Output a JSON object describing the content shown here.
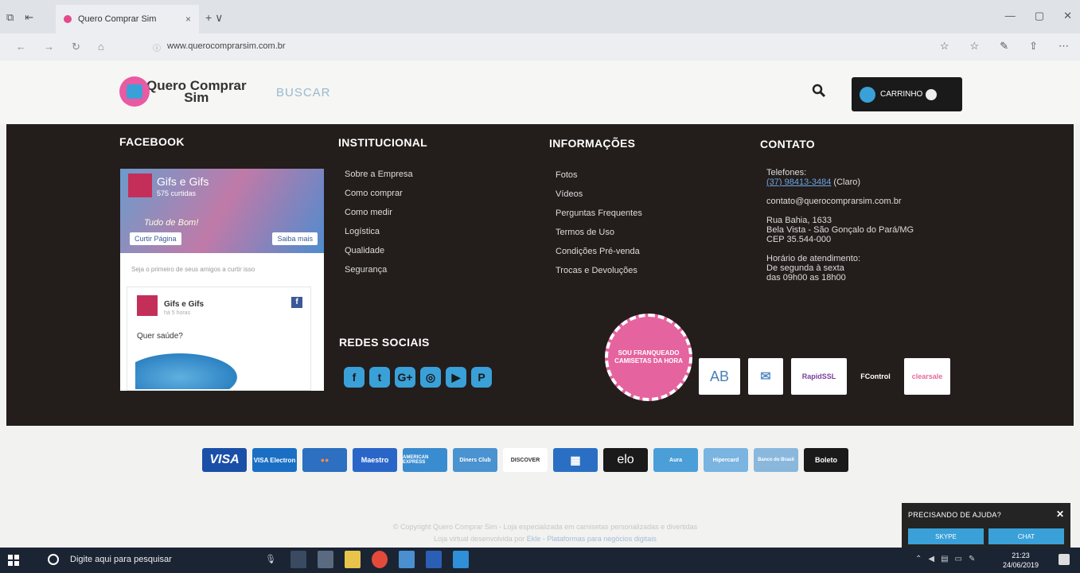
{
  "browser": {
    "tab_title": "Quero Comprar Sim",
    "tab_close": "×",
    "new_tab": "+ ∨",
    "url": "www.querocomprarsim.com.br",
    "window_controls": [
      "—",
      "▢",
      "✕"
    ]
  },
  "header": {
    "logo_line1": "Quero Comprar",
    "logo_line2": "Sim",
    "search_placeholder": "BUSCAR",
    "cart_label": "CARRINHO"
  },
  "footer": {
    "facebook_heading": "FACEBOOK",
    "institucional_heading": "INSTITUCIONAL",
    "informacoes_heading": "INFORMAÇÕES",
    "contato_heading": "CONTATO",
    "redes_heading": "REDES SOCIAIS",
    "fb": {
      "page_name": "Gifs e Gifs",
      "likes": "575 curtidas",
      "tagline": "Tudo de Bom!",
      "like_button": "Curtir Página",
      "more_button": "Saiba mais",
      "friends_text": "Seja o primeiro de seus amigos a curtir isso",
      "post_name": "Gifs e Gifs",
      "post_time": "há 5 horas",
      "post_text": "Quer saúde?"
    },
    "institucional_links": [
      "Sobre a Empresa",
      "Como comprar",
      "Como medir",
      "Logística",
      "Qualidade",
      "Segurança"
    ],
    "informacoes_links": [
      "Fotos",
      "Vídeos",
      "Perguntas Frequentes",
      "Termos de Uso",
      "Condições Pré-venda",
      "Trocas e Devoluções"
    ],
    "contact": {
      "phones_label": "Telefones:",
      "phone": "(37) 98413-3484",
      "phone_suffix": " (Claro)",
      "email": "contato@querocomprarsim.com.br",
      "address1": "Rua Bahia, 1633",
      "address2": "Bela Vista - São Gonçalo do Pará/MG",
      "address3": "CEP 35.544-000",
      "hours_label": "Horário de atendimento:",
      "hours1": "De segunda à sexta",
      "hours2": "das 09h00 as 18h00"
    },
    "social_icons": [
      "f",
      "t",
      "G+",
      "◎",
      "▶",
      "P"
    ],
    "seal_text": "SOU FRANQUEADO CAMISETAS DA HORA",
    "badges": [
      "AB",
      "✉",
      "RapidSSL",
      "FControl",
      "clearsale"
    ]
  },
  "payments": [
    "VISA",
    "VISA Electron",
    "●●",
    "Maestro",
    "AMERICAN EXPRESS",
    "Diners Club",
    "DISCOVER",
    "▦",
    "elo",
    "Aura",
    "Hipercard",
    "Banco do Brasil",
    "Boleto"
  ],
  "copyright": {
    "line1": "© Copyright Quero Comprar Sim - Loja especializada em camisetas personalizadas e divertidas",
    "line2_prefix": "Loja virtual desenvolvida por ",
    "line2_link": "Ekle - Plataformas para negócios digitais"
  },
  "help_widget": {
    "title": "PRECISANDO DE AJUDA?",
    "close": "✕",
    "skype": "SKYPE",
    "chat": "CHAT"
  },
  "taskbar": {
    "search_text": "Digite aqui para pesquisar",
    "time": "21:23",
    "date": "24/06/2019"
  }
}
